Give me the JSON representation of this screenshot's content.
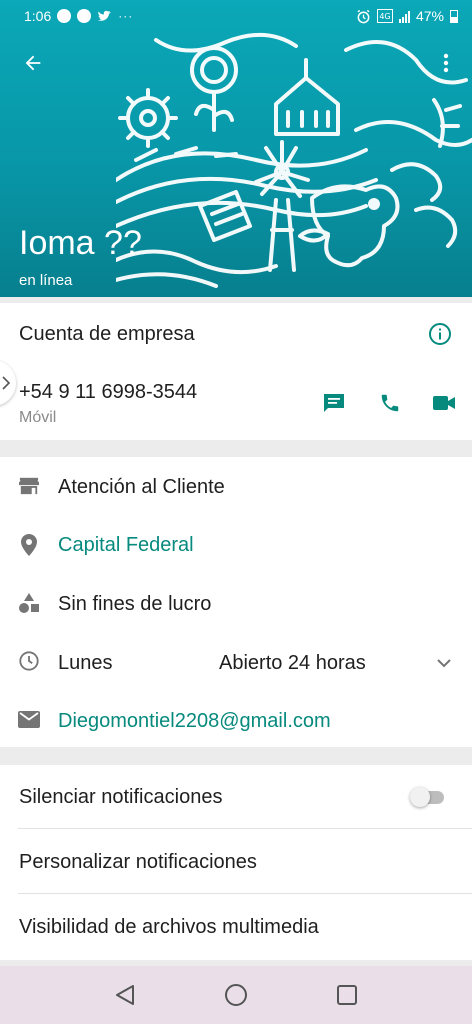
{
  "status_bar": {
    "time": "1:06",
    "dots": "···",
    "battery": "47%"
  },
  "header": {
    "name": "Ioma ??",
    "status": "en línea"
  },
  "business": {
    "account_type": "Cuenta de empresa",
    "phone": "+54 9 11 6998-3544",
    "phone_type": "Móvil"
  },
  "details": {
    "category": "Atención al Cliente",
    "location": "Capital Federal",
    "type": "Sin fines de lucro",
    "hours_day": "Lunes",
    "hours_value": "Abierto 24 horas",
    "email": "Diegomontiel2208@gmail.com"
  },
  "settings": {
    "mute": "Silenciar notificaciones",
    "mute_enabled": false,
    "custom": "Personalizar notificaciones",
    "media": "Visibilidad de archivos multimedia"
  },
  "colors": {
    "accent": "#078a7e",
    "header": "#0aa8b8"
  }
}
